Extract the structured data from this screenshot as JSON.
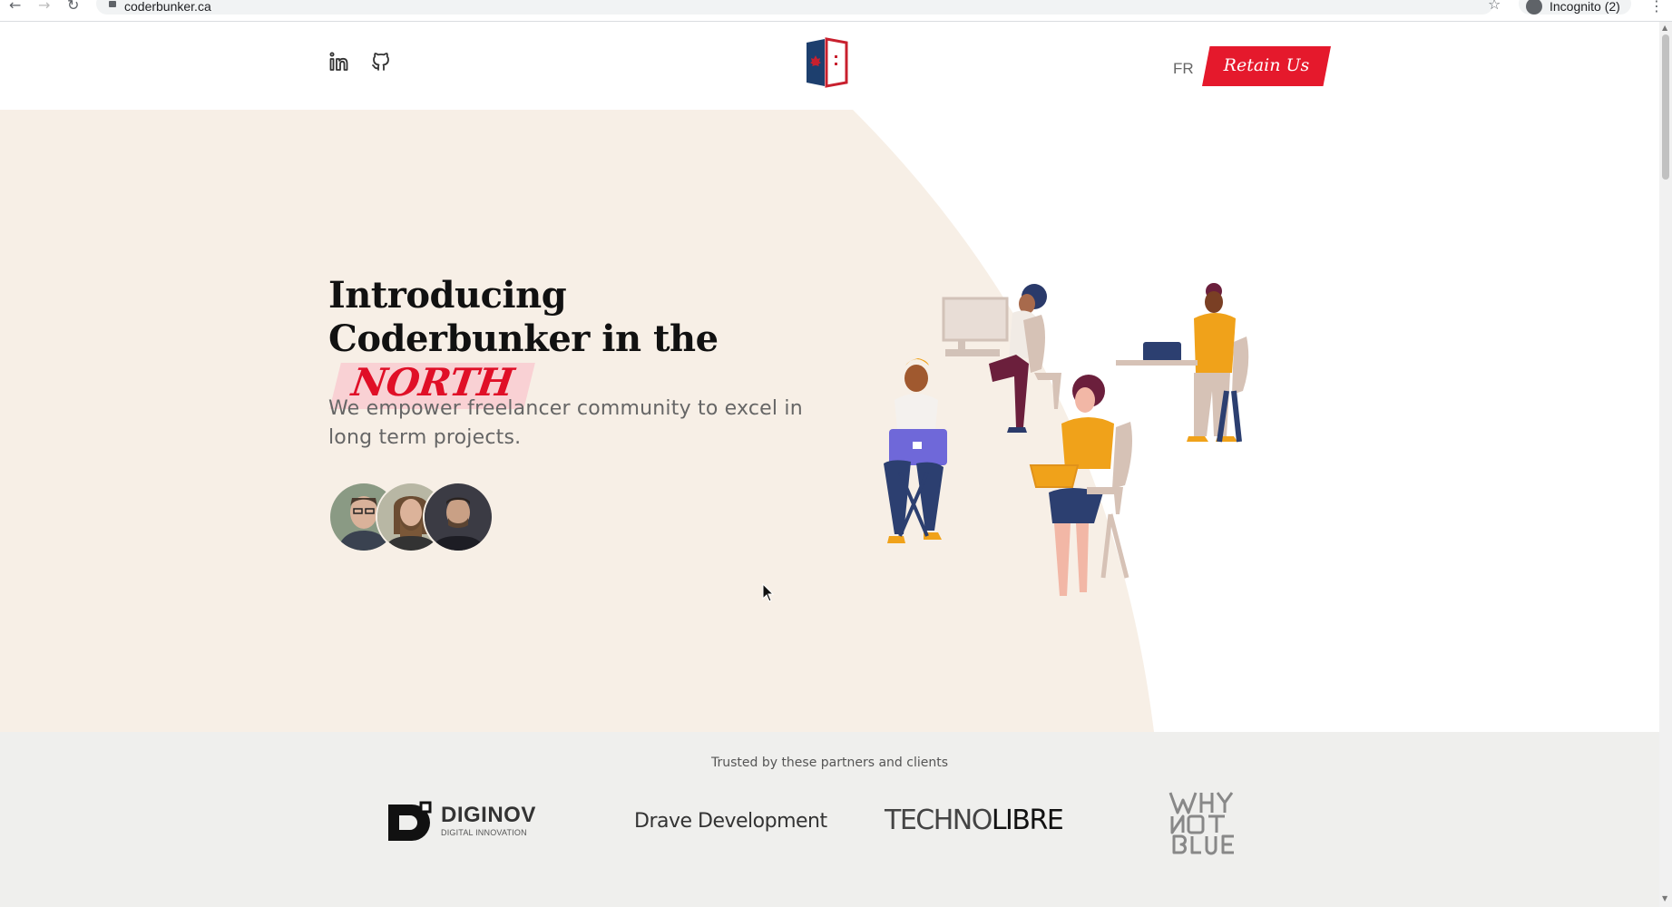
{
  "browser": {
    "url": "coderbunker.ca",
    "profile_label": "Incognito (2)"
  },
  "header": {
    "lang_label": "FR",
    "cta_label": "Retain Us"
  },
  "hero": {
    "headline_prefix": "Introducing Coderbunker in the",
    "headline_highlight": "NORTH",
    "subtitle": "We empower freelancer community to excel in long term projects."
  },
  "partners": {
    "caption": "Trusted by these partners and clients",
    "logos": [
      {
        "name": "DIGINOV",
        "tagline": "DIGITAL INNOVATION"
      },
      {
        "name": "Drave Development"
      },
      {
        "part1": "TECHNO",
        "part2": "LIBRE"
      },
      {
        "name": "WHY NOT BLUE"
      }
    ]
  },
  "colors": {
    "accent_red": "#e5192c",
    "hero_bg": "#f7efe6",
    "partners_bg": "#efefed"
  }
}
